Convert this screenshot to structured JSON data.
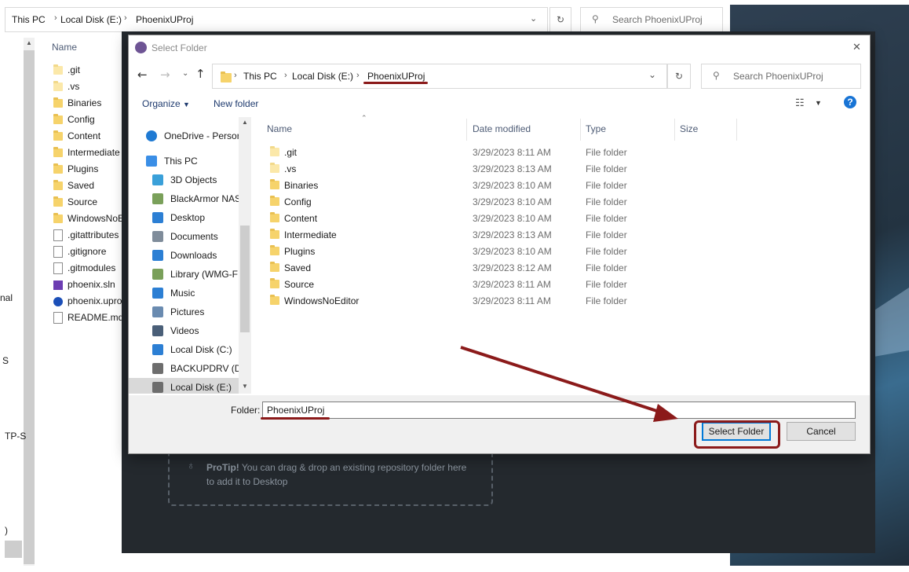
{
  "background_explorer": {
    "breadcrumb": [
      "This PC",
      "Local Disk (E:)",
      "PhoenixUProj"
    ],
    "search_placeholder": "Search PhoenixUProj",
    "column_name": "Name",
    "files": [
      {
        "name": ".git",
        "kind": "folder-light"
      },
      {
        "name": ".vs",
        "kind": "folder-light"
      },
      {
        "name": "Binaries",
        "kind": "folder"
      },
      {
        "name": "Config",
        "kind": "folder"
      },
      {
        "name": "Content",
        "kind": "folder"
      },
      {
        "name": "Intermediate",
        "kind": "folder"
      },
      {
        "name": "Plugins",
        "kind": "folder"
      },
      {
        "name": "Saved",
        "kind": "folder"
      },
      {
        "name": "Source",
        "kind": "folder"
      },
      {
        "name": "WindowsNoE",
        "kind": "folder"
      },
      {
        "name": ".gitattributes",
        "kind": "doc"
      },
      {
        "name": ".gitignore",
        "kind": "doc"
      },
      {
        "name": ".gitmodules",
        "kind": "doc"
      },
      {
        "name": "phoenix.sln",
        "kind": "sln"
      },
      {
        "name": "phoenix.upro",
        "kind": "uproject"
      },
      {
        "name": "README.md",
        "kind": "doc"
      }
    ],
    "left_edge_fragments": [
      "nal",
      "S",
      "TP-S",
      ")"
    ]
  },
  "github_desktop": {
    "protip_strong": "ProTip!",
    "protip_line1": " You can drag & drop an existing repository folder here",
    "protip_line2": "to add it to Desktop"
  },
  "dialog": {
    "title": "Select Folder",
    "close_glyph": "✕",
    "breadcrumb": [
      "This PC",
      "Local Disk (E:)",
      "PhoenixUProj"
    ],
    "search_placeholder": "Search PhoenixUProj",
    "toolbar": {
      "organize": "Organize",
      "new_folder": "New folder",
      "help": "?"
    },
    "nav": [
      {
        "label": "OneDrive - Persor",
        "icon": "cloud-icon"
      },
      {
        "label": "This PC",
        "icon": "computer-icon"
      },
      {
        "label": "3D Objects",
        "icon": "cube-icon"
      },
      {
        "label": "BlackArmor NAS",
        "icon": "network-drive-icon"
      },
      {
        "label": "Desktop",
        "icon": "desktop-icon"
      },
      {
        "label": "Documents",
        "icon": "documents-icon"
      },
      {
        "label": "Downloads",
        "icon": "download-icon"
      },
      {
        "label": "Library (WMG-F",
        "icon": "network-drive-icon"
      },
      {
        "label": "Music",
        "icon": "music-icon"
      },
      {
        "label": "Pictures",
        "icon": "pictures-icon"
      },
      {
        "label": "Videos",
        "icon": "videos-icon"
      },
      {
        "label": "Local Disk (C:)",
        "icon": "windows-drive-icon"
      },
      {
        "label": "BACKUPDRV (D:",
        "icon": "drive-icon"
      },
      {
        "label": "Local Disk (E:)",
        "icon": "drive-icon"
      }
    ],
    "columns": {
      "name": "Name",
      "date": "Date modified",
      "type": "Type",
      "size": "Size"
    },
    "rows": [
      {
        "name": ".git",
        "date": "3/29/2023 8:11 AM",
        "type": "File folder",
        "light": true
      },
      {
        "name": ".vs",
        "date": "3/29/2023 8:13 AM",
        "type": "File folder",
        "light": true
      },
      {
        "name": "Binaries",
        "date": "3/29/2023 8:10 AM",
        "type": "File folder",
        "light": false
      },
      {
        "name": "Config",
        "date": "3/29/2023 8:10 AM",
        "type": "File folder",
        "light": false
      },
      {
        "name": "Content",
        "date": "3/29/2023 8:10 AM",
        "type": "File folder",
        "light": false
      },
      {
        "name": "Intermediate",
        "date": "3/29/2023 8:13 AM",
        "type": "File folder",
        "light": false
      },
      {
        "name": "Plugins",
        "date": "3/29/2023 8:10 AM",
        "type": "File folder",
        "light": false
      },
      {
        "name": "Saved",
        "date": "3/29/2023 8:12 AM",
        "type": "File folder",
        "light": false
      },
      {
        "name": "Source",
        "date": "3/29/2023 8:11 AM",
        "type": "File folder",
        "light": false
      },
      {
        "name": "WindowsNoEditor",
        "date": "3/29/2023 8:11 AM",
        "type": "File folder",
        "light": false
      }
    ],
    "folder_label": "Folder:",
    "folder_value": "PhoenixUProj",
    "select_button": "Select Folder",
    "cancel_button": "Cancel"
  },
  "colors": {
    "annotation": "#8b1a1a",
    "dark_bg": "#24292e",
    "selection": "#d9d9d9",
    "accent": "#0078d7"
  }
}
